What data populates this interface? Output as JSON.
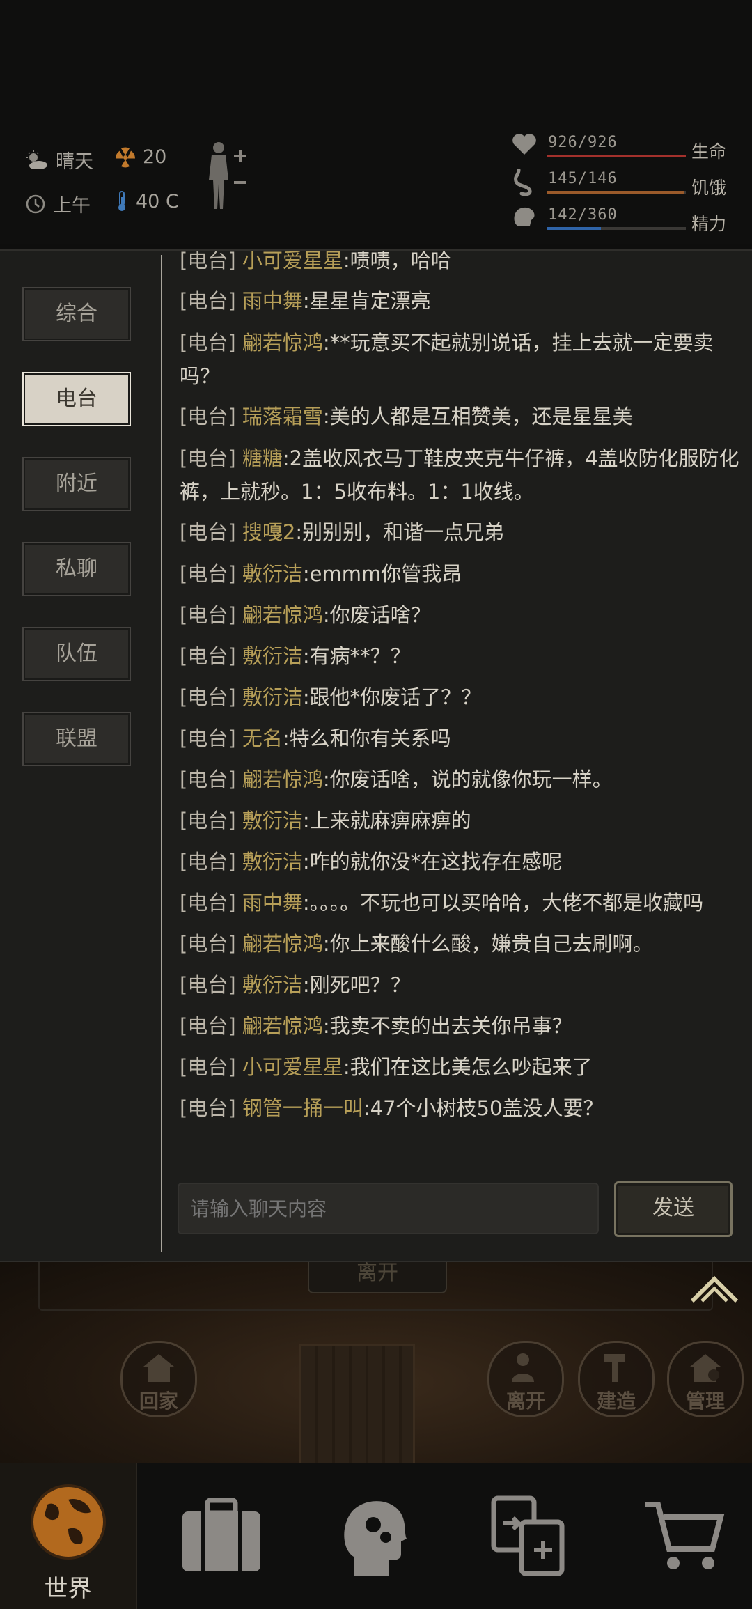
{
  "status": {
    "weather": "晴天",
    "radiation": "20",
    "time_of_day": "上午",
    "temperature": "40 C"
  },
  "vitals": [
    {
      "value": "926/926",
      "label": "生命",
      "fraction": 1.0,
      "color": "#a3312c"
    },
    {
      "value": "145/146",
      "label": "饥饿",
      "fraction": 0.99,
      "color": "#9a5a2a"
    },
    {
      "value": "142/360",
      "label": "精力",
      "fraction": 0.39,
      "color": "#2f64a8"
    }
  ],
  "channels": [
    {
      "label": "综合",
      "active": false
    },
    {
      "label": "电台",
      "active": true
    },
    {
      "label": "附近",
      "active": false
    },
    {
      "label": "私聊",
      "active": false
    },
    {
      "label": "队伍",
      "active": false
    },
    {
      "label": "联盟",
      "active": false
    }
  ],
  "messages": [
    {
      "tag": "[电台]",
      "nick": "小可爱星星",
      "text": ":啧啧，哈哈"
    },
    {
      "tag": "[电台]",
      "nick": "雨中舞",
      "text": ":星星肯定漂亮"
    },
    {
      "tag": "[电台]",
      "nick": "翩若惊鸿",
      "text": ":**玩意买不起就别说话，挂上去就一定要卖吗？"
    },
    {
      "tag": "[电台]",
      "nick": "瑞落霜雪",
      "text": ":美的人都是互相赞美，还是星星美"
    },
    {
      "tag": "[电台]",
      "nick": "糖糖",
      "text": ":2盖收风衣马丁鞋皮夹克牛仔裤，4盖收防化服防化裤，上就秒。1：5收布料。1：1收线。"
    },
    {
      "tag": "[电台]",
      "nick": "搜嘎2",
      "text": ":别别别，和谐一点兄弟"
    },
    {
      "tag": "[电台]",
      "nick": "敷衍洁",
      "text": ":emmm你管我昂"
    },
    {
      "tag": "[电台]",
      "nick": "翩若惊鸿",
      "text": ":你废话啥？"
    },
    {
      "tag": "[电台]",
      "nick": "敷衍洁",
      "text": ":有病**？？"
    },
    {
      "tag": "[电台]",
      "nick": "敷衍洁",
      "text": ":跟他*你废话了？？"
    },
    {
      "tag": "[电台]",
      "nick": "无名",
      "text": ":特么和你有关系吗"
    },
    {
      "tag": "[电台]",
      "nick": "翩若惊鸿",
      "text": ":你废话啥，说的就像你玩一样。"
    },
    {
      "tag": "[电台]",
      "nick": "敷衍洁",
      "text": ":上来就麻痹麻痹的"
    },
    {
      "tag": "[电台]",
      "nick": "敷衍洁",
      "text": ":咋的就你没*在这找存在感呢"
    },
    {
      "tag": "[电台]",
      "nick": "雨中舞",
      "text": ":。。。。不玩也可以买哈哈，大佬不都是收藏吗"
    },
    {
      "tag": "[电台]",
      "nick": "翩若惊鸿",
      "text": ":你上来酸什么酸，嫌贵自己去刷啊。"
    },
    {
      "tag": "[电台]",
      "nick": "敷衍洁",
      "text": ":刚死吧？？"
    },
    {
      "tag": "[电台]",
      "nick": "翩若惊鸿",
      "text": ":我卖不卖的出去关你吊事？"
    },
    {
      "tag": "[电台]",
      "nick": "小可爱星星",
      "text": ":我们在这比美怎么吵起来了"
    },
    {
      "tag": "[电台]",
      "nick": "钢管一捅一叫",
      "text": ":47个小树枝50盖没人要？"
    }
  ],
  "chat_input": {
    "placeholder": "请输入聊天内容",
    "value": ""
  },
  "send_label": "发送",
  "scene": {
    "leave_label": "离开",
    "actions": {
      "home": "回家",
      "leave": "离开",
      "build": "建造",
      "manage": "管理"
    }
  },
  "bottom_nav": {
    "world": "世界"
  }
}
